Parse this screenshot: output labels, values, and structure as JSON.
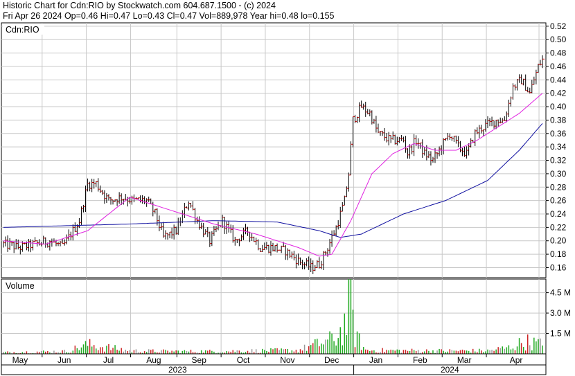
{
  "header": {
    "line1": "Historic Chart for Cdn:RIO by Stockwatch.com 604.687.1500 - (c) 2024",
    "line2": "Fri Apr 26 2024   Op=0.46  Hi=0.47  Lo=0.43  Cl=0.47  Vol=889,978  Year hi=0.48  lo=0.155"
  },
  "colors": {
    "background": "#ffffff",
    "grid": "#c8c8c8",
    "frame": "#000000",
    "bar": "#000000",
    "close_tick": "#cc0000",
    "ma_short": "#e020e0",
    "ma_long": "#1010a0",
    "volume_up": "#22aa22",
    "volume_down": "#cc2222",
    "volume_neutral": "#999999"
  },
  "chart_data": [
    {
      "type": "line",
      "subtype": "ohlc",
      "title": "Cdn:RIO",
      "xlabel": "",
      "ylabel": "",
      "ylim": [
        0.145,
        0.525
      ],
      "y_axis_side": "right",
      "grid": true,
      "y_ticks": [
        "0.52",
        "0.50",
        "0.48",
        "0.46",
        "0.44",
        "0.42",
        "0.40",
        "0.38",
        "0.36",
        "0.34",
        "0.32",
        "0.30",
        "0.28",
        "0.26",
        "0.24",
        "0.22",
        "0.20",
        "0.18",
        "0.16"
      ],
      "x_month_labels": [
        "May",
        "Jun",
        "Jul",
        "Aug",
        "Sep",
        "Oct",
        "Nov",
        "Dec",
        "Jan",
        "Feb",
        "Mar",
        "Apr"
      ],
      "x_year_labels": [
        "2023",
        "2024"
      ],
      "series": [
        {
          "style": "ohlc-bars",
          "anchors": [
            [
              0,
              0.195
            ],
            [
              8,
              0.19
            ],
            [
              15,
              0.195
            ],
            [
              22,
              0.2
            ],
            [
              28,
              0.19
            ],
            [
              32,
              0.21
            ],
            [
              36,
              0.23
            ],
            [
              40,
              0.285
            ],
            [
              44,
              0.285
            ],
            [
              50,
              0.26
            ],
            [
              56,
              0.265
            ],
            [
              62,
              0.26
            ],
            [
              68,
              0.26
            ],
            [
              72,
              0.24
            ],
            [
              76,
              0.205
            ],
            [
              82,
              0.215
            ],
            [
              88,
              0.26
            ],
            [
              92,
              0.23
            ],
            [
              98,
              0.2
            ],
            [
              104,
              0.23
            ],
            [
              110,
              0.2
            ],
            [
              116,
              0.215
            ],
            [
              122,
              0.19
            ],
            [
              128,
              0.19
            ],
            [
              134,
              0.185
            ],
            [
              140,
              0.17
            ],
            [
              146,
              0.16
            ],
            [
              150,
              0.165
            ],
            [
              154,
              0.19
            ],
            [
              158,
              0.22
            ],
            [
              162,
              0.26
            ],
            [
              164,
              0.3
            ],
            [
              166,
              0.38
            ],
            [
              170,
              0.4
            ],
            [
              174,
              0.39
            ],
            [
              178,
              0.36
            ],
            [
              184,
              0.35
            ],
            [
              190,
              0.35
            ],
            [
              192,
              0.33
            ],
            [
              196,
              0.35
            ],
            [
              200,
              0.33
            ],
            [
              204,
              0.32
            ],
            [
              208,
              0.34
            ],
            [
              212,
              0.36
            ],
            [
              216,
              0.34
            ],
            [
              220,
              0.33
            ],
            [
              224,
              0.36
            ],
            [
              228,
              0.37
            ],
            [
              234,
              0.38
            ],
            [
              238,
              0.38
            ],
            [
              242,
              0.43
            ],
            [
              246,
              0.44
            ],
            [
              250,
              0.42
            ],
            [
              254,
              0.46
            ],
            [
              256,
              0.47
            ]
          ]
        },
        {
          "name": "",
          "style": "moving-average-short",
          "points": [
            [
              0,
              0.2
            ],
            [
              20,
              0.195
            ],
            [
              40,
              0.215
            ],
            [
              60,
              0.265
            ],
            [
              80,
              0.245
            ],
            [
              100,
              0.225
            ],
            [
              120,
              0.21
            ],
            [
              140,
              0.19
            ],
            [
              150,
              0.177
            ],
            [
              156,
              0.18
            ],
            [
              165,
              0.23
            ],
            [
              175,
              0.3
            ],
            [
              185,
              0.33
            ],
            [
              195,
              0.345
            ],
            [
              205,
              0.335
            ],
            [
              215,
              0.335
            ],
            [
              225,
              0.35
            ],
            [
              235,
              0.37
            ],
            [
              245,
              0.39
            ],
            [
              256,
              0.42
            ]
          ]
        },
        {
          "name": "",
          "style": "moving-average-long",
          "points": [
            [
              0,
              0.22
            ],
            [
              60,
              0.225
            ],
            [
              100,
              0.23
            ],
            [
              130,
              0.228
            ],
            [
              150,
              0.215
            ],
            [
              160,
              0.205
            ],
            [
              170,
              0.21
            ],
            [
              190,
              0.24
            ],
            [
              210,
              0.26
            ],
            [
              230,
              0.29
            ],
            [
              245,
              0.335
            ],
            [
              256,
              0.375
            ]
          ]
        }
      ]
    },
    {
      "type": "bar",
      "title": "Volume",
      "ylabel": "",
      "ylim": [
        0,
        5500000
      ],
      "y_axis_side": "right",
      "y_ticks": [
        "4.5 M",
        "3.0 M",
        "1.5 M"
      ],
      "anchors": [
        [
          0,
          150000
        ],
        [
          30,
          250000
        ],
        [
          40,
          900000
        ],
        [
          60,
          300000
        ],
        [
          80,
          250000
        ],
        [
          100,
          250000
        ],
        [
          120,
          300000
        ],
        [
          140,
          350000
        ],
        [
          150,
          1000000
        ],
        [
          158,
          1500000
        ],
        [
          163,
          3200000
        ],
        [
          165,
          5500000
        ],
        [
          167,
          1800000
        ],
        [
          172,
          350000
        ],
        [
          200,
          300000
        ],
        [
          230,
          300000
        ],
        [
          240,
          600000
        ],
        [
          248,
          1200000
        ],
        [
          256,
          900000
        ]
      ]
    }
  ]
}
